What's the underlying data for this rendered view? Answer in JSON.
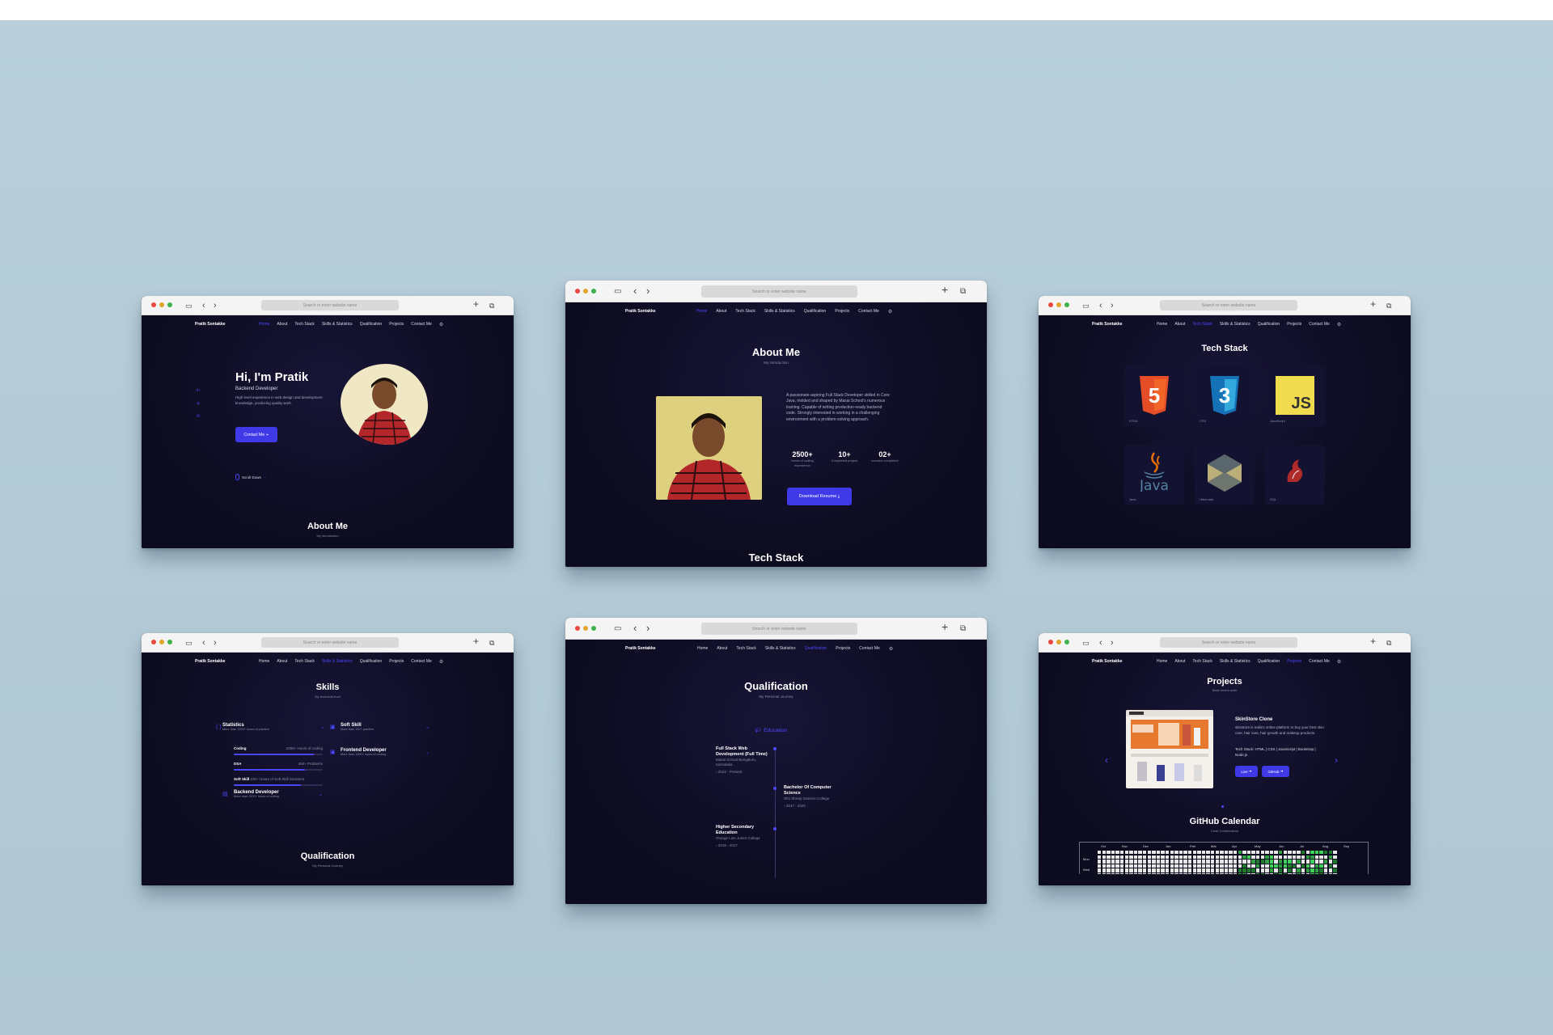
{
  "browser": {
    "url_placeholder": "Search or enter website name",
    "new_tab": "+",
    "back": "‹",
    "forward": "›"
  },
  "nav": {
    "brand": "Pratik Sontakke",
    "links": [
      "Home",
      "About",
      "Tech Stack",
      "Skills & Statistics",
      "Qualification",
      "Projects",
      "Contact Me"
    ],
    "theme_toggle": "⚙"
  },
  "colors": {
    "accent": "#4b47ff",
    "page_bg": "#0d0b1e",
    "backdrop": "#b7cdd8"
  },
  "home": {
    "greeting": "Hi, I'm Pratik",
    "role": "Backend Developer",
    "description": "High level experience in web design and development knowledge, producing quality work.",
    "contact_button": "Contact Me",
    "scroll_down": "Scroll Down",
    "next_title": "About Me",
    "next_sub": "My introduction"
  },
  "about": {
    "title": "About Me",
    "subtitle": "My introduction",
    "text": "A passionate aspiring Full Stack Developer skilled in Core Java, molded and shaped by Masai School's numerous training. Capable of writing production-ready backend code. Strongly interested in working in a challenging environment with a problem-solving approach.",
    "stats": [
      {
        "value": "2500+",
        "label": "hours of coding experience"
      },
      {
        "value": "10+",
        "label": "Completed project"
      },
      {
        "value": "02+",
        "label": "courses completed"
      }
    ],
    "download_button": "Download Resume",
    "next_title": "Tech Stack"
  },
  "tech": {
    "title": "Tech Stack",
    "items": [
      "HTML",
      "CSS",
      "JavaScript",
      "Java",
      "Hibernate",
      "SQL"
    ]
  },
  "skills": {
    "title": "Skills",
    "subtitle": "My technical level",
    "groups_left": [
      {
        "name": "Statistics",
        "desc": "More than 1200+ hours of practice"
      }
    ],
    "bars": [
      {
        "name": "Coding",
        "value": "1000+ Hours of coding",
        "level": 0.9
      },
      {
        "name": "DSA",
        "value": "300+ Problems",
        "level": 0.8
      },
      {
        "name": "Soft Skill",
        "value": "100+ Hours of Soft Skill Sessions",
        "level": 0.75
      }
    ],
    "backend": {
      "name": "Backend Developer",
      "desc": "More than 1200+ hours of coding"
    },
    "soft": {
      "name": "Soft Skill",
      "desc": "More than 150+ practice"
    },
    "frontend": {
      "name": "Frontend Developer",
      "desc": "More than 1000+ hours of coding"
    },
    "next_title": "Qualification",
    "next_sub": "My Personal Journey"
  },
  "qualification": {
    "title": "Qualification",
    "subtitle": "My Personal Journey",
    "tab": "Education",
    "items": [
      {
        "title": "Full Stack Web Development (Full Time)",
        "place": "Masai School Bengaluru, Karnataka",
        "date": "2022 - Present"
      },
      {
        "title": "Bachelor Of Computer Science",
        "place": "Shri Shivaji Science College",
        "date": "2017 - 2020"
      },
      {
        "title": "Higher Secondary Education",
        "place": "Orange Line Junior College",
        "date": "2016 - 2017"
      }
    ]
  },
  "projects": {
    "title": "Projects",
    "subtitle": "Most recent work",
    "project_name": "SkinStore Clone",
    "project_desc": "skinstore is India's online platform to buy your best skin care, hair care, hair growth and makeup products.",
    "tech_stack": "Tech Stack: HTML | CSS | JavaScript | Bootstrap | Node.js",
    "live_button": "Live",
    "github_button": "GitHub",
    "calendar_title": "GitHub Calendar",
    "calendar_sub": "Code Contributions",
    "months": [
      "Oct",
      "Nov",
      "Dec",
      "Jan",
      "Feb",
      "Mar",
      "Apr",
      "May",
      "Jun",
      "Jul",
      "Aug",
      "Sep"
    ],
    "day_labels": [
      "Mon",
      "Wed"
    ]
  }
}
